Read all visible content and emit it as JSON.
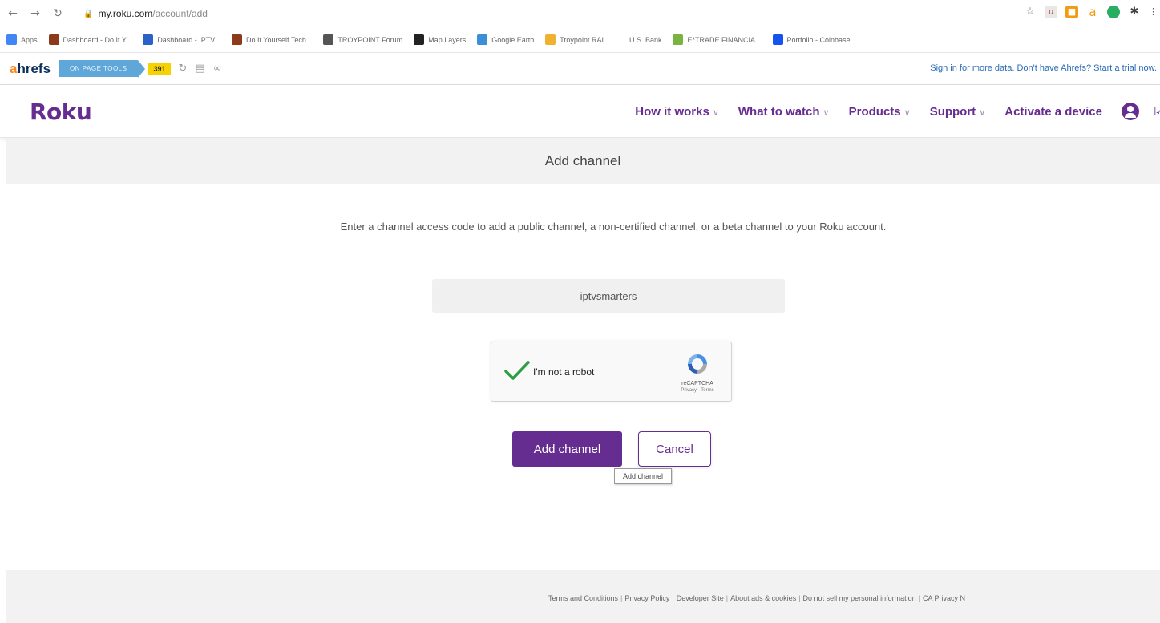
{
  "browser": {
    "url_host": "my.roku.com",
    "url_path": "/account/add"
  },
  "bookmarks": [
    {
      "label": "Apps",
      "color": "#4285f4"
    },
    {
      "label": "Dashboard - Do It Y...",
      "color": "#8b3a1a"
    },
    {
      "label": "Dashboard - IPTV...",
      "color": "#2a62c9"
    },
    {
      "label": "Do It Yourself Tech...",
      "color": "#8b3a1a"
    },
    {
      "label": "TROYPOINT Forum",
      "color": "#555555"
    },
    {
      "label": "Map Layers",
      "color": "#222222"
    },
    {
      "label": "Google Earth",
      "color": "#3c8fd6"
    },
    {
      "label": "Troypoint RAI",
      "color": "#f0b030"
    },
    {
      "label": "U.S. Bank",
      "color": "#ffffff"
    },
    {
      "label": "E*TRADE FINANCIA...",
      "color": "#7ab342"
    },
    {
      "label": "Portfolio - Coinbase",
      "color": "#1652f0"
    }
  ],
  "ahrefs": {
    "logo_a": "a",
    "logo_rest": "hrefs",
    "tools_label": "ON PAGE TOOLS",
    "dr_badge": "391",
    "signin_text": "Sign in for more data. Don't have Ahrefs? Start a trial now."
  },
  "roku": {
    "logo": "Roku",
    "nav": [
      {
        "label": "How it works",
        "has_chevron": true
      },
      {
        "label": "What to watch",
        "has_chevron": true
      },
      {
        "label": "Products",
        "has_chevron": true
      },
      {
        "label": "Support",
        "has_chevron": true
      },
      {
        "label": "Activate a device",
        "has_chevron": false
      }
    ],
    "brand_color": "#662d91"
  },
  "page": {
    "title": "Add channel",
    "intro": "Enter a channel access code to add a public channel, a non-certified channel, or a beta channel to your Roku account.",
    "code_value": "iptvsmarters"
  },
  "captcha": {
    "label": "I'm not a robot",
    "brand": "reCAPTCHA",
    "links": "Privacy - Terms",
    "checked": true
  },
  "buttons": {
    "add": "Add channel",
    "cancel": "Cancel",
    "tooltip": "Add channel"
  },
  "footer": {
    "links": [
      "Terms and Conditions",
      "Privacy Policy",
      "Developer Site",
      "About ads & cookies",
      "Do not sell my personal information",
      "CA Privacy N"
    ]
  }
}
